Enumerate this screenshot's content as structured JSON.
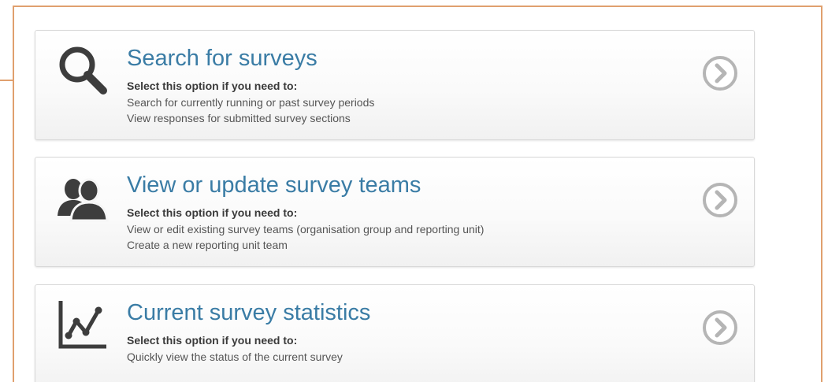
{
  "cards": [
    {
      "title": "Search for surveys",
      "lead": "Select this option if you need to:",
      "lines": [
        "Search for currently running or past survey periods",
        "View responses for submitted survey sections"
      ],
      "icon": "search-icon"
    },
    {
      "title": "View or update survey teams",
      "lead": "Select this option if you need to:",
      "lines": [
        "View or edit existing survey teams (organisation group and reporting unit)",
        "Create a new reporting unit team"
      ],
      "icon": "users-icon"
    },
    {
      "title": "Current survey statistics",
      "lead": "Select this option if you need to:",
      "lines": [
        "Quickly view the status of the current survey"
      ],
      "icon": "line-chart-icon"
    }
  ],
  "colors": {
    "panel_border": "#e0a06e",
    "title": "#3a7ca5",
    "icon": "#3d3d3d",
    "chevron": "#b5b5b5"
  }
}
